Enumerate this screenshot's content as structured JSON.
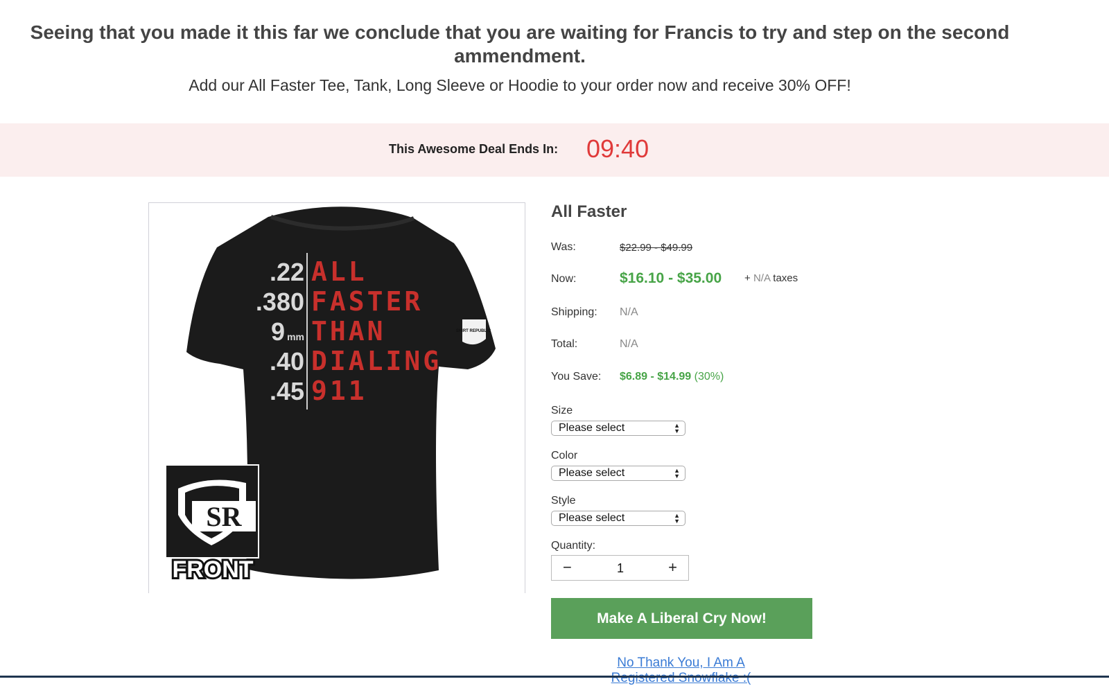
{
  "headline": "Seeing that you made it this far we conclude that you are waiting for Francis to try and step on the second ammendment.",
  "subheadline": "Add our All Faster Tee, Tank, Long Sleeve or Hoodie to your order now and receive 30% OFF!",
  "deal": {
    "label": "This Awesome Deal Ends In:",
    "timer": "09:40"
  },
  "product": {
    "title": "All Faster",
    "image": {
      "calibers": [
        ".22",
        ".380",
        "9",
        "mm",
        ".40",
        ".45"
      ],
      "words": [
        "ALL",
        "FASTER",
        "THAN",
        "DIALING",
        "911"
      ],
      "logo_text": "SR",
      "badge_text": "FRONT",
      "sleeve_text": "SHIRT REPUBLIC"
    },
    "was_label": "Was:",
    "was_value": "$22.99 - $49.99",
    "now_label": "Now:",
    "now_value": "$16.10 - $35.00",
    "taxes_prefix": "+ ",
    "taxes_na": "N/A",
    "taxes_suffix": " taxes",
    "shipping_label": "Shipping:",
    "shipping_value": "N/A",
    "total_label": "Total:",
    "total_value": "N/A",
    "save_label": "You Save:",
    "save_value": "$6.89 - $14.99",
    "save_percent": " (30%)"
  },
  "options": {
    "size_label": "Size",
    "size_value": "Please select",
    "color_label": "Color",
    "color_value": "Please select",
    "style_label": "Style",
    "style_value": "Please select"
  },
  "quantity": {
    "label": "Quantity:",
    "minus": "−",
    "value": "1",
    "plus": "+"
  },
  "cta_label": "Make A Liberal Cry Now!",
  "decline_label": "No Thank You, I Am A Registered Snowflake :(",
  "colors": {
    "accent_green": "#5aa05a",
    "price_green": "#47a447",
    "timer_red": "#e03a3a",
    "deal_bg": "#fbeeee",
    "link_blue": "#3a7bd5"
  }
}
